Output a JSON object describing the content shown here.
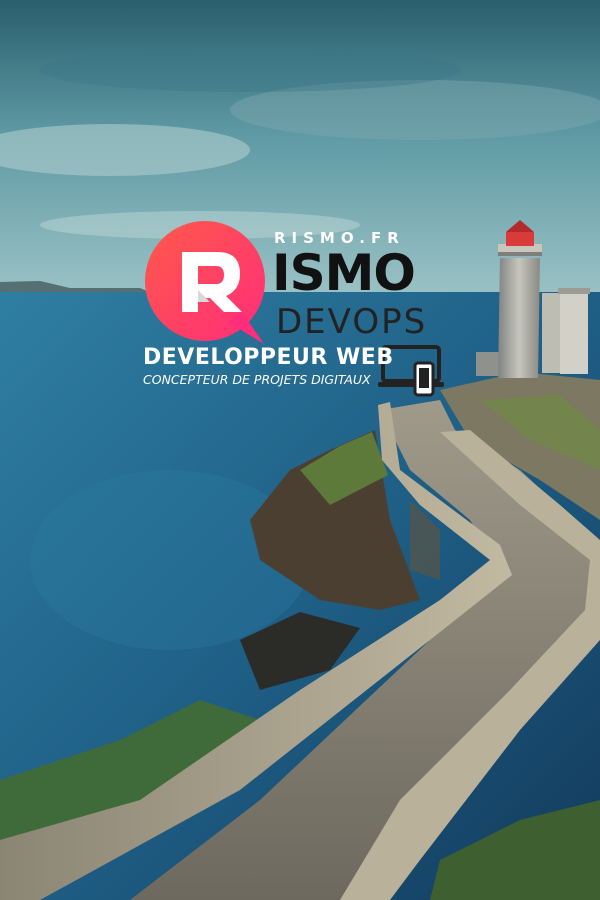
{
  "brand": {
    "site": "RISMO.FR",
    "name": "ISMO",
    "logo_letter": "R",
    "subtitle": "DEVOPS",
    "tagline_main": "DEVELOPPEUR WEB",
    "tagline_sub": "CONCEPTEUR DE PROJETS DIGITAUX",
    "accent_gradient": [
      "#ff4f4f",
      "#ff2d7a"
    ]
  },
  "icons": [
    "logo-r-icon",
    "laptop-icon",
    "phone-icon"
  ],
  "scene": "Lighthouse on a rocky coastal point with a winding stone causeway under a teal sky"
}
